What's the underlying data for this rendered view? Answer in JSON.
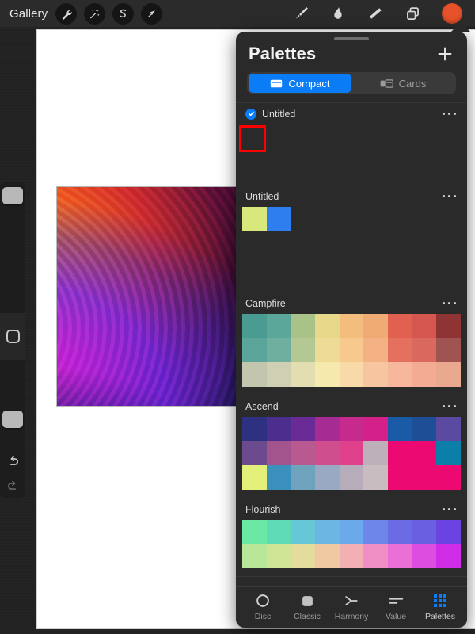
{
  "toolbar": {
    "gallery_label": "Gallery",
    "tools": [
      {
        "name": "actions-wrench",
        "icon": "wrench-icon"
      },
      {
        "name": "adjustments-wand",
        "icon": "magic-wand-icon"
      },
      {
        "name": "selection-s",
        "icon": "selection-icon"
      },
      {
        "name": "transform-arrow",
        "icon": "transform-arrow-icon"
      }
    ],
    "right_tools": [
      {
        "name": "paint-brush",
        "icon": "brush-icon"
      },
      {
        "name": "smudge",
        "icon": "smudge-icon"
      },
      {
        "name": "eraser",
        "icon": "eraser-icon"
      },
      {
        "name": "layers",
        "icon": "layers-icon"
      }
    ],
    "color_swatch": "#e8522a"
  },
  "sidebar": {
    "brush_size_value": 88,
    "opacity_value": 42,
    "modify_label": "modify-button",
    "undo_label": "undo",
    "redo_label": "redo"
  },
  "panel": {
    "title": "Palettes",
    "add_label": "+",
    "segments": [
      {
        "label": "Compact",
        "icon": "compact-card-icon",
        "active": true
      },
      {
        "label": "Cards",
        "icon": "cards-icon",
        "active": false
      }
    ],
    "palettes": [
      {
        "name": "Untitled",
        "selected": true,
        "columns": 9,
        "rows": 3,
        "colors": [],
        "empty": true,
        "highlight_swatch": true
      },
      {
        "name": "Untitled",
        "selected": false,
        "columns": 9,
        "rows": 3,
        "empty": true,
        "loose_colors": [
          "#d9e87a",
          "#2f7ef0"
        ]
      },
      {
        "name": "Campfire",
        "selected": false,
        "columns": 9,
        "rows": 3,
        "colors": [
          "#4a9b91",
          "#5ba79a",
          "#a8c288",
          "#e8d88a",
          "#f3bd7e",
          "#f0ab74",
          "#e2604f",
          "#d4564f",
          "#8e3434",
          "#5aa49a",
          "#6faf9f",
          "#b4c894",
          "#eedc96",
          "#f7c98f",
          "#f3b184",
          "#e6705e",
          "#d9685f",
          "#a05452",
          "#c3c5ae",
          "#cfcfb4",
          "#e3ddb2",
          "#f6e9ae",
          "#f8d9a8",
          "#f7c5a0",
          "#f6b79c",
          "#f3ab93",
          "#e9a98f"
        ]
      },
      {
        "name": "Ascend",
        "selected": false,
        "columns": 9,
        "rows": 3,
        "colors": [
          "#2e3080",
          "#4b2e8e",
          "#6a2b97",
          "#a62b93",
          "#c72a8d",
          "#d4218a",
          "#1a5ba8",
          "#1e4f96",
          "#5b4aa0",
          "#6b4a8e",
          "#a3548c",
          "#b8598f",
          "#cf4e8d",
          "#e0418c",
          "#bdb0b8",
          "#ec0a72",
          "#ec0a72",
          "#0c7fa8",
          "#e2f07a",
          "#3b90bd",
          "#6fa3bd",
          "#9aa9c3",
          "#b7adba",
          "#c9bcc0",
          "#ec0a72",
          "#ec0a72",
          "#ec0a72"
        ]
      },
      {
        "name": "Flourish",
        "selected": false,
        "columns": 9,
        "rows": 2,
        "colors": [
          "#6ae8a4",
          "#5fdcb6",
          "#66c8d6",
          "#6cb6e4",
          "#6aa9ec",
          "#6e86ea",
          "#6b6ce4",
          "#6a5fe0",
          "#6a43e2",
          "#b8e79a",
          "#cfe595",
          "#e3dc9d",
          "#f0c9a2",
          "#f2b0b4",
          "#ef8fc6",
          "#ea6fd6",
          "#dd4ee0",
          "#cf2ce8"
        ]
      }
    ]
  },
  "tabbar": {
    "tabs": [
      {
        "label": "Disc",
        "icon": "disc-icon",
        "active": false
      },
      {
        "label": "Classic",
        "icon": "classic-square-icon",
        "active": false
      },
      {
        "label": "Harmony",
        "icon": "harmony-icon",
        "active": false
      },
      {
        "label": "Value",
        "icon": "value-lines-icon",
        "active": false
      },
      {
        "label": "Palettes",
        "icon": "palettes-grid-icon",
        "active": true
      }
    ]
  },
  "colors": {
    "accent_blue": "#0a7cf5",
    "panel_bg": "#2a2a2a",
    "toolbar_bg": "#2b2b2b",
    "highlight_red": "#ff0000",
    "canvas_white": "#ffffff"
  }
}
